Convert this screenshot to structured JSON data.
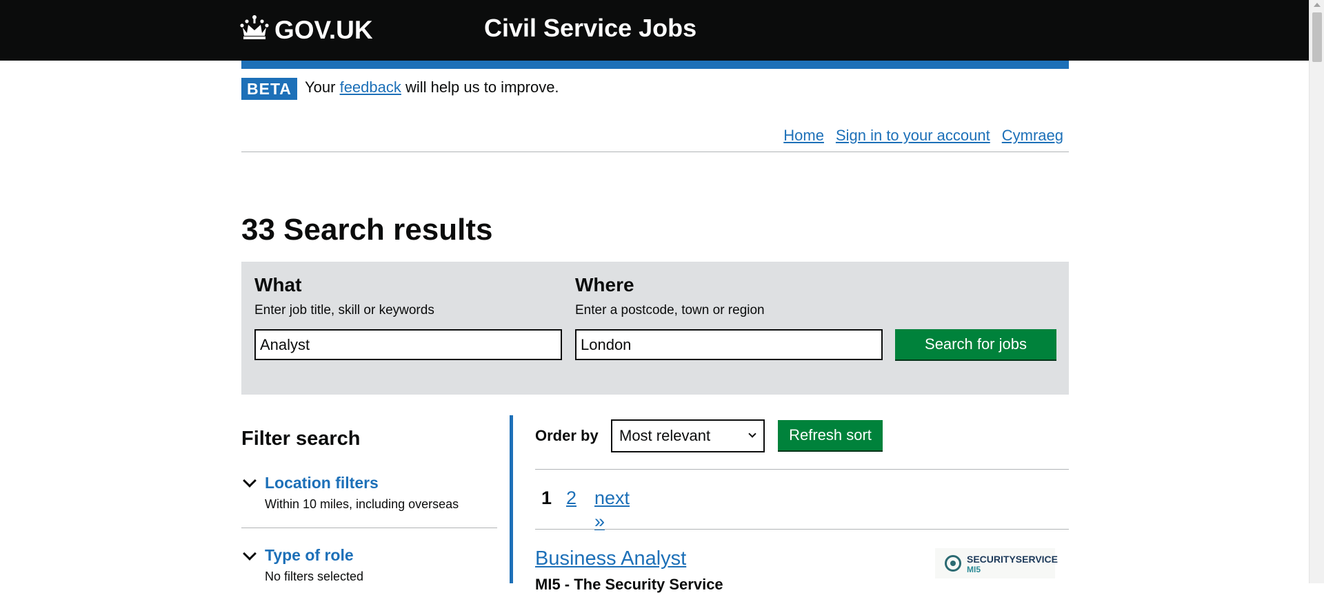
{
  "header": {
    "logo_text": "GOV.UK",
    "service_name": "Civil Service Jobs"
  },
  "beta_banner": {
    "tag": "BETA",
    "text_before": "Your",
    "link": "feedback",
    "text_after": "will help us to improve."
  },
  "nav": {
    "items": [
      {
        "label": "Home"
      },
      {
        "label": "Sign in to your account"
      },
      {
        "label": "Cymraeg"
      }
    ]
  },
  "page": {
    "title": "33 Search results"
  },
  "search": {
    "what_label": "What",
    "what_hint": "Enter job title, skill or keywords",
    "what_value": "Analyst",
    "where_label": "Where",
    "where_hint": "Enter a postcode, town or region",
    "where_value": "London",
    "button_label": "Search for jobs"
  },
  "filters": {
    "title": "Filter search",
    "items": [
      {
        "label": "Location filters",
        "summary": "Within 10 miles, including overseas"
      },
      {
        "label": "Type of role",
        "summary": "No filters selected"
      }
    ]
  },
  "results": {
    "order_label": "Order by",
    "order_value": "Most relevant",
    "refresh_label": "Refresh sort",
    "pagination": {
      "current": "1",
      "page_2": "2",
      "next": "next »"
    },
    "jobs": [
      {
        "title": "Business Analyst",
        "organisation": "MI5 - The Security Service",
        "logo_line1": "SECURITYSERVICE",
        "logo_line2": "MI5"
      }
    ]
  },
  "colors": {
    "header_bg": "#0b0c0c",
    "brand_blue": "#1d70b8",
    "button_green": "#00823b",
    "panel_grey": "#dee0e2"
  }
}
